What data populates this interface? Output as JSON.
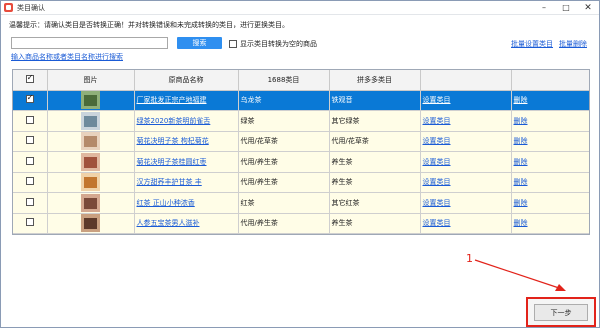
{
  "window": {
    "title": "类目确认",
    "controls": [
      "minimize-icon",
      "maximize-icon",
      "close-icon"
    ]
  },
  "tip": "温馨提示：请确认类目是否转换正确！并对转换错误和未完成转换的类目，进行更换类目。",
  "search": {
    "value": "",
    "placeholder": "",
    "button_label": "搜索"
  },
  "convert_empty": {
    "label": "显示类目转换为空的商品",
    "checked": false
  },
  "hint": "输入商品名称或者类目名称进行搜索",
  "actions": {
    "batch_set_label": "批量设置类目",
    "batch_delete_label": "批量删除"
  },
  "table": {
    "headers": [
      "",
      "图片",
      "原商品名称",
      "1688类目",
      "拼多多类目",
      "",
      ""
    ],
    "rows": [
      {
        "checked": true,
        "selected": true,
        "name": "厂家批发正宗产地福建",
        "cat1688": "乌龙茶",
        "catpdd": "铁观音",
        "set": "设置类目",
        "del": "删除"
      },
      {
        "checked": false,
        "selected": false,
        "name": "绿茶2020新茶明前雀舌",
        "cat1688": "绿茶",
        "catpdd": "其它绿茶",
        "set": "设置类目",
        "del": "删除"
      },
      {
        "checked": false,
        "selected": false,
        "name": "菊花决明子茶 枸杞菊花",
        "cat1688": "代用/花草茶",
        "catpdd": "代用/花草茶",
        "set": "设置类目",
        "del": "删除"
      },
      {
        "checked": false,
        "selected": false,
        "name": "菊花决明子茶桂圆红枣",
        "cat1688": "代用/养生茶",
        "catpdd": "养生茶",
        "set": "设置类目",
        "del": "删除"
      },
      {
        "checked": false,
        "selected": false,
        "name": "汉方甜荞丰护甘茶 丰",
        "cat1688": "代用/养生茶",
        "catpdd": "养生茶",
        "set": "设置类目",
        "del": "删除"
      },
      {
        "checked": false,
        "selected": false,
        "name": "红茶 正山小种浓香",
        "cat1688": "红茶",
        "catpdd": "其它红茶",
        "set": "设置类目",
        "del": "删除"
      },
      {
        "checked": false,
        "selected": false,
        "name": "人参五宝茶男人滋补",
        "cat1688": "代用/养生茶",
        "catpdd": "养生茶",
        "set": "设置类目",
        "del": "删除"
      }
    ]
  },
  "annotation": {
    "number": "1"
  },
  "next_button": {
    "label": "下一步"
  },
  "colors": {
    "accent": "#2f8ff0",
    "selected_row": "#0a79d6",
    "row_bg": "#fffde7",
    "link": "#1a5bd6",
    "annotation": "#e2231a"
  }
}
